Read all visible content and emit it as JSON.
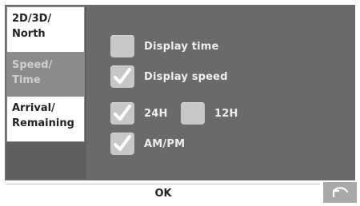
{
  "sidebar": {
    "tabs": [
      {
        "line1": "2D/3D/",
        "line2": "North",
        "selected": false
      },
      {
        "line1": "Speed/",
        "line2": "Time",
        "selected": true
      },
      {
        "line1": "Arrival/",
        "line2": "Remaining",
        "selected": false
      }
    ]
  },
  "options": {
    "display_time": {
      "label": "Display time",
      "checked": false
    },
    "display_speed": {
      "label": "Display speed",
      "checked": true
    },
    "h24": {
      "label": "24H",
      "checked": true
    },
    "h12": {
      "label": "12H",
      "checked": false
    },
    "ampm": {
      "label": "AM/PM",
      "checked": true
    }
  },
  "footer": {
    "ok_label": "OK"
  },
  "icons": {
    "check": "check-icon",
    "back": "undo-arrow-icon"
  },
  "colors": {
    "panel": "#6a6a6a",
    "selected_tab": "#8b8b8b",
    "checkbox": "#c7c7c7",
    "check": "#ffffff"
  }
}
